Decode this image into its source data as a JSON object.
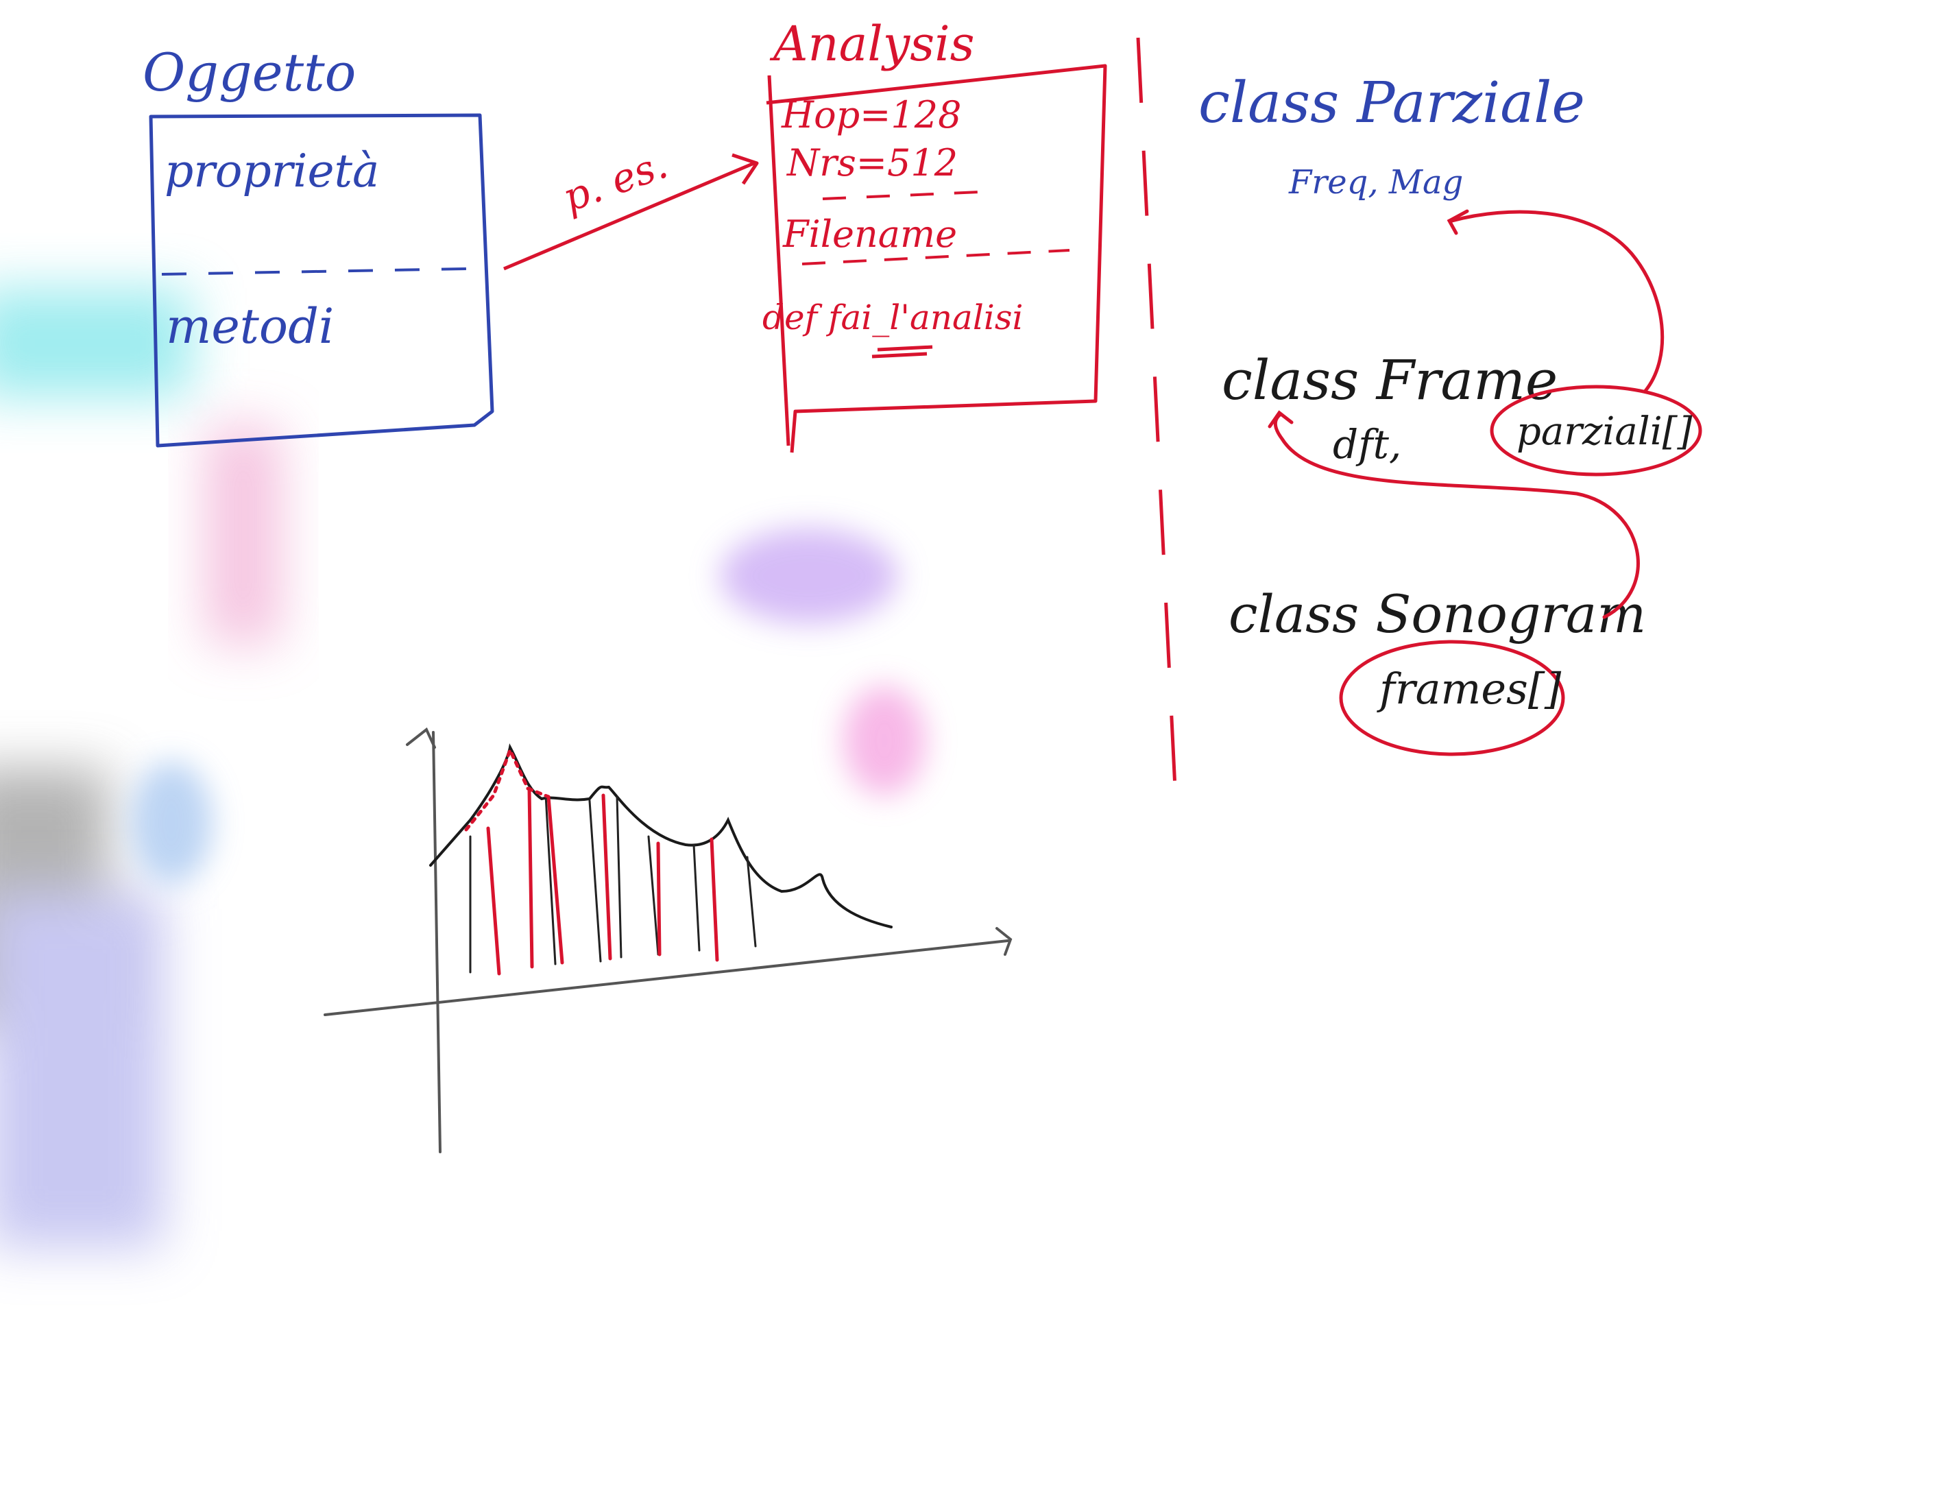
{
  "board": {
    "colors": {
      "blue": "#2f45b0",
      "red": "#d8132e",
      "black": "#1a1a1a"
    }
  },
  "object_box": {
    "title": "Oggetto",
    "properties_label": "proprietà",
    "methods_label": "metodi"
  },
  "arrow_label": "p. es.",
  "analysis_box": {
    "title": "Analysis",
    "lines": [
      "Hop=128",
      "Nrs=512",
      "Filename",
      "def fai_l'analisi"
    ]
  },
  "classes": {
    "parziale": {
      "name": "class Parziale",
      "attributes": "Freq, Mag"
    },
    "frame": {
      "name": "class Frame",
      "attributes": "dft,",
      "member": "parziali[]"
    },
    "sonogram": {
      "name": "class Sonogram",
      "member": "frames[]"
    }
  }
}
